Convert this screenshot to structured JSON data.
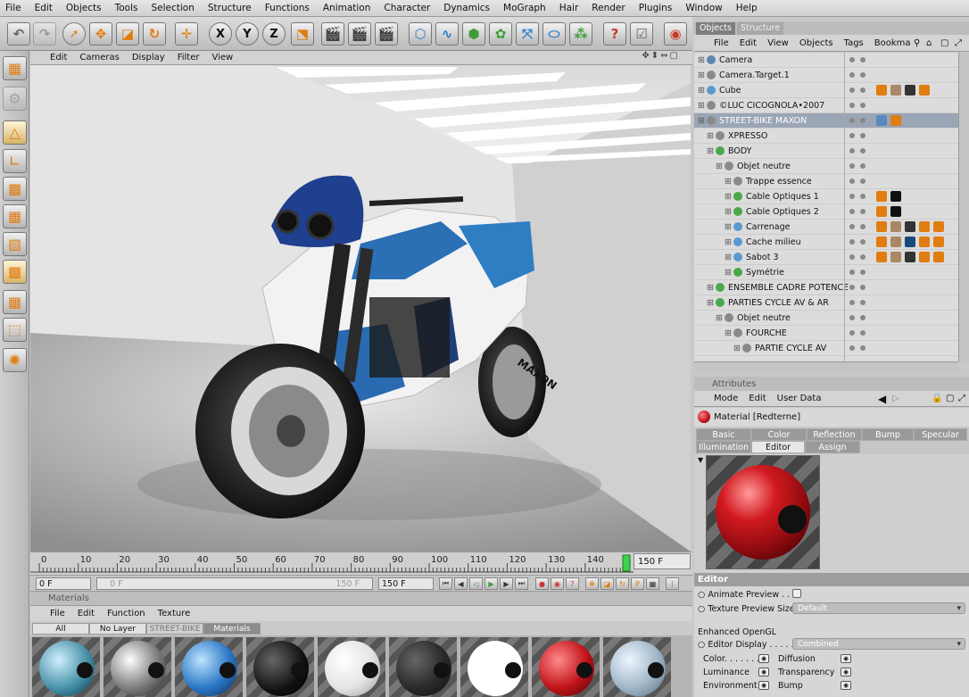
{
  "menubar": [
    "File",
    "Edit",
    "Objects",
    "Tools",
    "Selection",
    "Structure",
    "Functions",
    "Animation",
    "Character",
    "Dynamics",
    "MoGraph",
    "Hair",
    "Render",
    "Plugins",
    "Window",
    "Help"
  ],
  "toolbar": {
    "axis_x": "X",
    "axis_y": "Y",
    "axis_z": "Z"
  },
  "viewport": {
    "menu": [
      "Edit",
      "Cameras",
      "Display",
      "Filter",
      "View"
    ],
    "nav_icons": "✥⬍⇔▢",
    "bike_brand": "MAXON"
  },
  "timeline": {
    "ticks": [
      "0",
      "10",
      "20",
      "30",
      "40",
      "50",
      "60",
      "70",
      "80",
      "90",
      "100",
      "110",
      "120",
      "130",
      "140",
      "1"
    ],
    "current_frame": "150 F",
    "start_field": "0 F",
    "min_field": "0 F",
    "max_field": "150 F",
    "end_field": "150 F"
  },
  "materials": {
    "title": "Materials",
    "menu": [
      "File",
      "Edit",
      "Function",
      "Texture"
    ],
    "tabs": [
      "All",
      "No Layer",
      "STREET-BIKE",
      "Materials"
    ]
  },
  "objects": {
    "tabs": [
      "Objects",
      "Structure"
    ],
    "menu": [
      "File",
      "Edit",
      "View",
      "Objects",
      "Tags",
      "Bookma"
    ],
    "rows": [
      {
        "name": "Camera",
        "indent": 0
      },
      {
        "name": "Camera.Target.1",
        "indent": 0
      },
      {
        "name": "Cube",
        "indent": 0
      },
      {
        "name": "©LUC CICOGNOLA•2007",
        "indent": 0
      },
      {
        "name": "STREET-BIKE MAXON",
        "indent": 0
      },
      {
        "name": "XPRESSO",
        "indent": 1
      },
      {
        "name": "BODY",
        "indent": 1
      },
      {
        "name": "Objet neutre",
        "indent": 2
      },
      {
        "name": "Trappe essence",
        "indent": 3
      },
      {
        "name": "Cable Optiques 1",
        "indent": 3
      },
      {
        "name": "Cable Optiques 2",
        "indent": 3
      },
      {
        "name": "Carrenage",
        "indent": 3
      },
      {
        "name": "Cache milieu",
        "indent": 3
      },
      {
        "name": "Sabot 3",
        "indent": 3
      },
      {
        "name": "Symétrie",
        "indent": 3
      },
      {
        "name": "ENSEMBLE CADRE POTENCE",
        "indent": 1
      },
      {
        "name": "PARTIES CYCLE AV & AR",
        "indent": 1
      },
      {
        "name": "Objet neutre",
        "indent": 2
      },
      {
        "name": "FOURCHE",
        "indent": 3
      },
      {
        "name": "PARTIE CYCLE AV",
        "indent": 4
      }
    ]
  },
  "attributes": {
    "title": "Attributes",
    "menu": [
      "Mode",
      "Edit",
      "User Data"
    ],
    "material_name": "Material [Redterne]",
    "tabs_row1": [
      "Basic",
      "Color",
      "Reflection",
      "Bump",
      "Specular"
    ],
    "tabs_row2": [
      "Illumination",
      "Editor",
      "Assign"
    ],
    "section": "Editor",
    "animate_preview": "Animate Preview . . . .",
    "texture_preview_size": "Texture Preview Size",
    "texture_preview_value": "Default",
    "enhanced_opengl": "Enhanced OpenGL",
    "editor_display": "Editor Display . . . . . . . .",
    "editor_display_value": "Combined",
    "channels": [
      {
        "left": "Color. . . . . . . .",
        "right": "Diffusion"
      },
      {
        "left": "Luminance",
        "right": "Transparency"
      },
      {
        "left": "Environment",
        "right": "Bump"
      }
    ]
  },
  "colors": {
    "accent": "#e07d10",
    "active_tab": "#7e7e7e",
    "material_red": "#c0141a"
  }
}
